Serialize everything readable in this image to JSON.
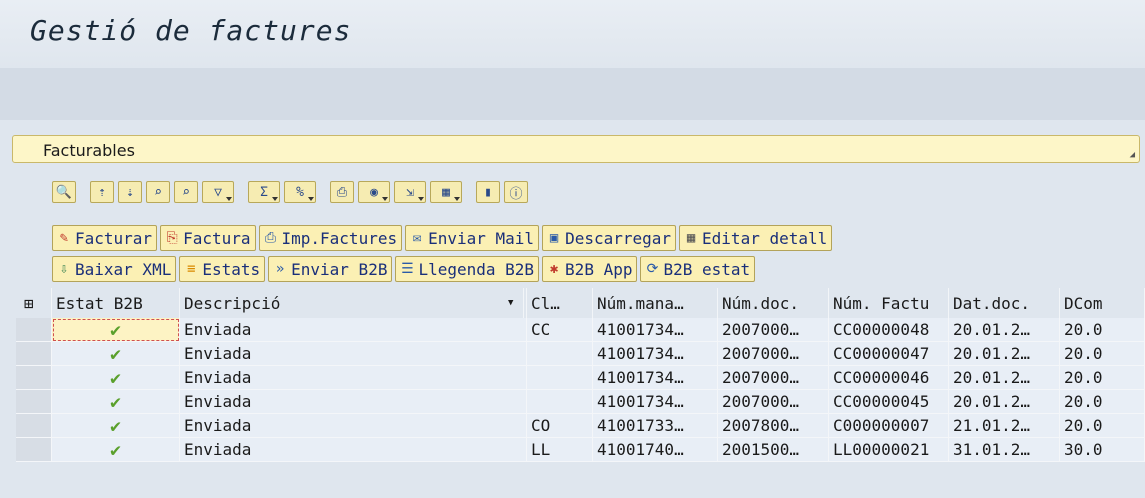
{
  "window": {
    "title": "Gestió de factures"
  },
  "section": {
    "label": "Facturables"
  },
  "toolbar_icons": [
    "details-icon",
    "sort-ascending-icon",
    "sort-descending-icon",
    "find-icon",
    "find-next-icon",
    "filter-icon",
    "sum-icon",
    "subtotal-icon",
    "print-icon",
    "view-icon",
    "export-icon",
    "layout-icon",
    "graphic-icon",
    "info-icon"
  ],
  "buttons_row1": [
    {
      "label": "Facturar",
      "icon": "pencil-icon"
    },
    {
      "label": "Factura",
      "icon": "pdf-icon"
    },
    {
      "label": "Imp.Factures",
      "icon": "printer-icon"
    },
    {
      "label": "Enviar Mail",
      "icon": "mail-icon"
    },
    {
      "label": "Descarregar",
      "icon": "save-icon"
    },
    {
      "label": "Editar detall",
      "icon": "grid-icon"
    }
  ],
  "buttons_row2": [
    {
      "label": "Baixar XML",
      "icon": "download-icon"
    },
    {
      "label": "Estats",
      "icon": "states-icon"
    },
    {
      "label": "Enviar B2B",
      "icon": "send-icon"
    },
    {
      "label": "Llegenda B2B",
      "icon": "legend-icon"
    },
    {
      "label": "B2B App",
      "icon": "app-icon"
    },
    {
      "label": "B2B estat",
      "icon": "refresh-icon"
    }
  ],
  "table": {
    "columns": [
      "Estat B2B",
      "Descripció",
      "Cl…",
      "Núm.mana…",
      "Núm.doc.",
      "Núm. Factu",
      "Dat.doc.",
      "DCom"
    ],
    "rows": [
      {
        "estat": "✔",
        "desc": "Enviada",
        "cl": "CC",
        "num_mana": "41001734…",
        "num_doc": "2007000…",
        "num_factu": "CC00000048",
        "dat_doc": "20.01.2…",
        "dcom": "20.0"
      },
      {
        "estat": "✔",
        "desc": "Enviada",
        "cl": "",
        "num_mana": "41001734…",
        "num_doc": "2007000…",
        "num_factu": "CC00000047",
        "dat_doc": "20.01.2…",
        "dcom": "20.0"
      },
      {
        "estat": "✔",
        "desc": "Enviada",
        "cl": "",
        "num_mana": "41001734…",
        "num_doc": "2007000…",
        "num_factu": "CC00000046",
        "dat_doc": "20.01.2…",
        "dcom": "20.0"
      },
      {
        "estat": "✔",
        "desc": "Enviada",
        "cl": "",
        "num_mana": "41001734…",
        "num_doc": "2007000…",
        "num_factu": "CC00000045",
        "dat_doc": "20.01.2…",
        "dcom": "20.0"
      },
      {
        "estat": "✔",
        "desc": "Enviada",
        "cl": "CO",
        "num_mana": "41001733…",
        "num_doc": "2007800…",
        "num_factu": "C000000007",
        "dat_doc": "21.01.2…",
        "dcom": "20.0"
      },
      {
        "estat": "✔",
        "desc": "Enviada",
        "cl": "LL",
        "num_mana": "41001740…",
        "num_doc": "2001500…",
        "num_factu": "LL00000021",
        "dat_doc": "31.01.2…",
        "dcom": "30.0"
      }
    ]
  },
  "colors": {
    "row_bg": "#e8eef6",
    "check": "#5aa02c",
    "header_bg": "#fdf6c8",
    "button_bg": "#fbf0b4",
    "button_text": "#1a2f7a"
  }
}
